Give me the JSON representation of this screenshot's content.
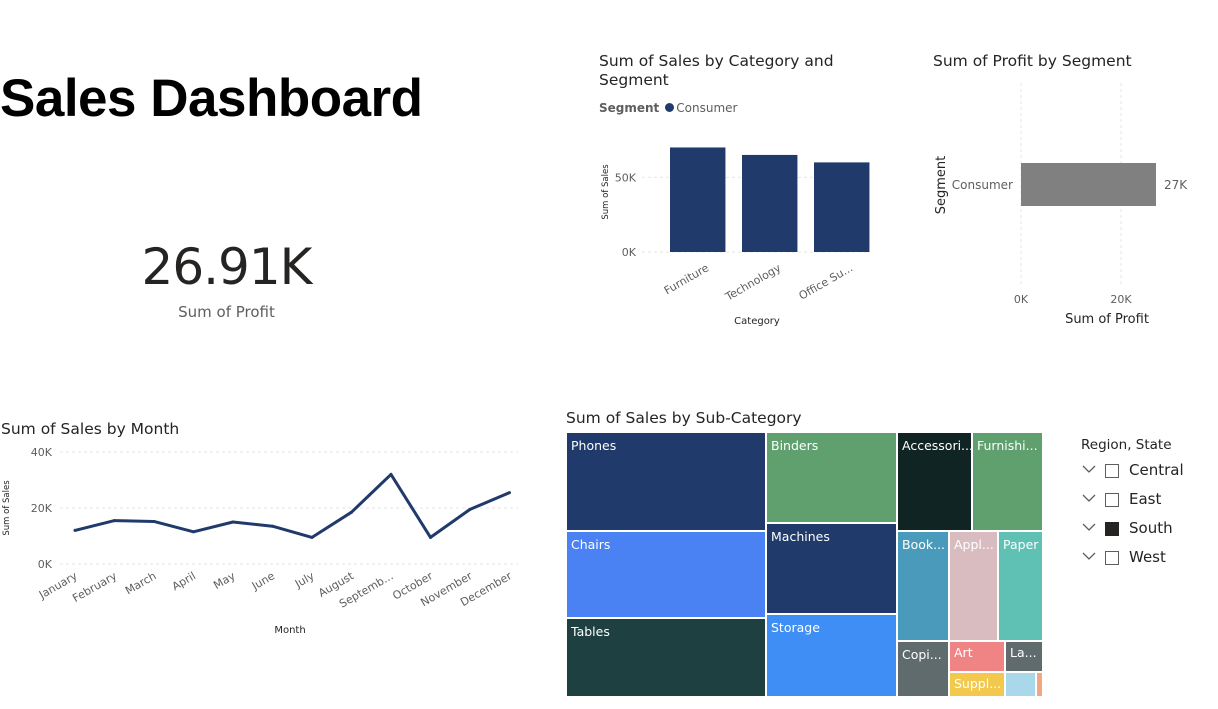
{
  "page": {
    "title": "Sales Dashboard"
  },
  "kpi": {
    "value": "26.91K",
    "label": "Sum of Profit"
  },
  "category_chart": {
    "title_line1": "Sum of Sales by Category and",
    "title_line2": "Segment",
    "legend_title": "Segment",
    "legend_item": "Consumer",
    "color": "#1f3a6b"
  },
  "segment_chart": {
    "title": "Sum of Profit by Segment",
    "color": "#808080"
  },
  "month_chart": {
    "title": "Sum of Sales by Month",
    "color": "#1f3a6b"
  },
  "treemap": {
    "title": "Sum of Sales by Sub-Category",
    "cells": [
      {
        "label": "Phones",
        "color": "#1f3a6b"
      },
      {
        "label": "Chairs",
        "color": "#4a82f4"
      },
      {
        "label": "Tables",
        "color": "#1f4040"
      },
      {
        "label": "Binders",
        "color": "#5fa06e"
      },
      {
        "label": "Machines",
        "color": "#1f3a6b"
      },
      {
        "label": "Storage",
        "color": "#3f8ef5"
      },
      {
        "label": "Accessori...",
        "color": "#102423"
      },
      {
        "label": "Furnishi...",
        "color": "#5fa06e"
      },
      {
        "label": "Book...",
        "color": "#4a9abb"
      },
      {
        "label": "Appl...",
        "color": "#d9bcbf"
      },
      {
        "label": "Paper",
        "color": "#5ec1b4"
      },
      {
        "label": "Copi...",
        "color": "#5f6b6d"
      },
      {
        "label": "Art",
        "color": "#f08484"
      },
      {
        "label": "La...",
        "color": "#5f6b6d"
      },
      {
        "label": "Suppl...",
        "color": "#f2c94c"
      },
      {
        "label": "",
        "color": "#a8d8ea"
      },
      {
        "label": "",
        "color": "#f4a582"
      }
    ]
  },
  "slicer": {
    "title": "Region, State",
    "items": [
      {
        "label": "Central",
        "checked": false
      },
      {
        "label": "East",
        "checked": false
      },
      {
        "label": "South",
        "checked": true
      },
      {
        "label": "West",
        "checked": false
      }
    ]
  },
  "chart_data": [
    {
      "type": "bar",
      "title": "Sum of Sales by Category and Segment",
      "xlabel": "Category",
      "ylabel": "Sum of Sales",
      "categories": [
        "Furniture",
        "Technology",
        "Office Su..."
      ],
      "series": [
        {
          "name": "Consumer",
          "values": [
            70000,
            65000,
            60000
          ]
        }
      ],
      "ylim": [
        0,
        75000
      ],
      "yticks": [
        "0K",
        "50K"
      ],
      "legend": "top-left",
      "grid": true
    },
    {
      "type": "bar",
      "orientation": "horizontal",
      "title": "Sum of Profit by Segment",
      "xlabel": "Sum of Profit",
      "ylabel": "Segment",
      "categories": [
        "Consumer"
      ],
      "values": [
        27000
      ],
      "data_labels": [
        "27K"
      ],
      "xlim": [
        0,
        30000
      ],
      "xticks": [
        "0K",
        "20K"
      ],
      "grid": true
    },
    {
      "type": "line",
      "title": "Sum of Sales by Month",
      "xlabel": "Month",
      "ylabel": "Sum of Sales",
      "categories": [
        "January",
        "February",
        "March",
        "April",
        "May",
        "June",
        "July",
        "August",
        "Septemb...",
        "October",
        "November",
        "December"
      ],
      "values": [
        12000,
        15500,
        15200,
        11500,
        15000,
        13500,
        9500,
        18500,
        32000,
        9500,
        19500,
        25500
      ],
      "ylim": [
        0,
        40000
      ],
      "yticks": [
        "0K",
        "20K",
        "40K"
      ],
      "grid": true
    }
  ]
}
